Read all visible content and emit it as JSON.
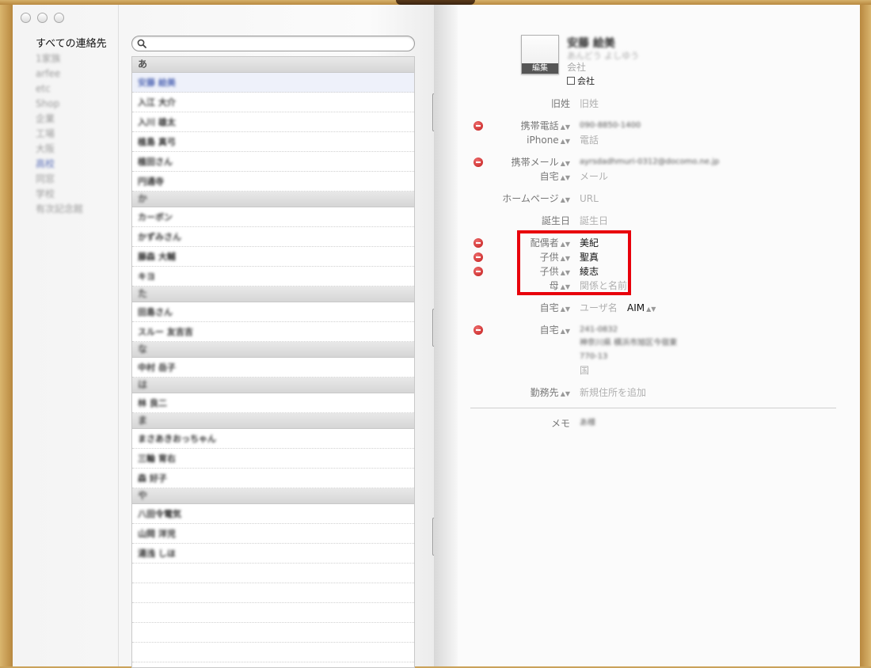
{
  "groups": {
    "all": "すべての連絡先",
    "items": [
      "1家族",
      "arfee",
      "etc",
      "Shop",
      "企業",
      "工場",
      "大阪",
      "高校",
      "同窓",
      "学校",
      "有次記念館"
    ]
  },
  "contacts": [
    {
      "type": "header",
      "text": "あ"
    },
    {
      "type": "row",
      "text": "安藤 絵美",
      "selected": true
    },
    {
      "type": "row",
      "text": "入江 大介"
    },
    {
      "type": "row",
      "text": "入川 雄太"
    },
    {
      "type": "row",
      "text": "植島 真弓"
    },
    {
      "type": "row",
      "text": "植田さん"
    },
    {
      "type": "row",
      "text": "円通寺"
    },
    {
      "type": "header",
      "text": "か"
    },
    {
      "type": "row",
      "text": "カーボン"
    },
    {
      "type": "row",
      "text": "かずみさん"
    },
    {
      "type": "row",
      "text": "藤森 大輔"
    },
    {
      "type": "row",
      "text": "キヨ"
    },
    {
      "type": "header",
      "text": "た"
    },
    {
      "type": "row",
      "text": "田島さん"
    },
    {
      "type": "row",
      "text": "スルー 友吉吉"
    },
    {
      "type": "header",
      "text": "な"
    },
    {
      "type": "row",
      "text": "中村 岳子"
    },
    {
      "type": "header",
      "text": "は"
    },
    {
      "type": "row",
      "text": "林 良二"
    },
    {
      "type": "header",
      "text": "ま"
    },
    {
      "type": "row",
      "text": "まさあきおっちゃん"
    },
    {
      "type": "row",
      "text": "三輪 育右"
    },
    {
      "type": "row",
      "text": "森 好子"
    },
    {
      "type": "header",
      "text": "や"
    },
    {
      "type": "row",
      "text": "八田令電気"
    },
    {
      "type": "row",
      "text": "山岡 洋児"
    },
    {
      "type": "row",
      "text": "湯浅 しほ"
    },
    {
      "type": "row",
      "text": ""
    },
    {
      "type": "row",
      "text": ""
    },
    {
      "type": "row",
      "text": ""
    },
    {
      "type": "row",
      "text": ""
    },
    {
      "type": "row",
      "text": ""
    }
  ],
  "card": {
    "edit_label": "編集",
    "name": "安藤 絵美",
    "phonetic": "あんどう よしゆう",
    "company_placeholder": "会社",
    "company_checkbox": "会社",
    "fields": {
      "maiden": {
        "label": "旧姓",
        "value": "旧姓"
      },
      "mobile": {
        "label": "携帯電話",
        "value": "090-8850-1400"
      },
      "iphone": {
        "label": "iPhone",
        "value": "電話"
      },
      "mobile_mail": {
        "label": "携帯メール",
        "value": "ayrsdadhmuri-0312@docomo.ne.jp"
      },
      "home_mail": {
        "label": "自宅",
        "value": "メール"
      },
      "homepage": {
        "label": "ホームページ",
        "value": "URL"
      },
      "birthday": {
        "label": "誕生日",
        "value": "誕生日"
      },
      "spouse": {
        "label": "配偶者",
        "value": "美紀"
      },
      "child1": {
        "label": "子供",
        "value": "聖真"
      },
      "child2": {
        "label": "子供",
        "value": "綾志"
      },
      "mother": {
        "label": "母",
        "value": "関係と名前"
      },
      "im": {
        "label": "自宅",
        "value": "ユーザ名",
        "service": "AIM"
      },
      "address": {
        "label": "自宅",
        "lines": [
          "241-0832",
          "神奈川県 横浜市旭区今宿東",
          "770-13"
        ],
        "country": "国"
      },
      "work": {
        "label": "勤務先",
        "value": "新規住所を追加"
      },
      "memo": {
        "label": "メモ",
        "value": "あ様"
      }
    }
  }
}
